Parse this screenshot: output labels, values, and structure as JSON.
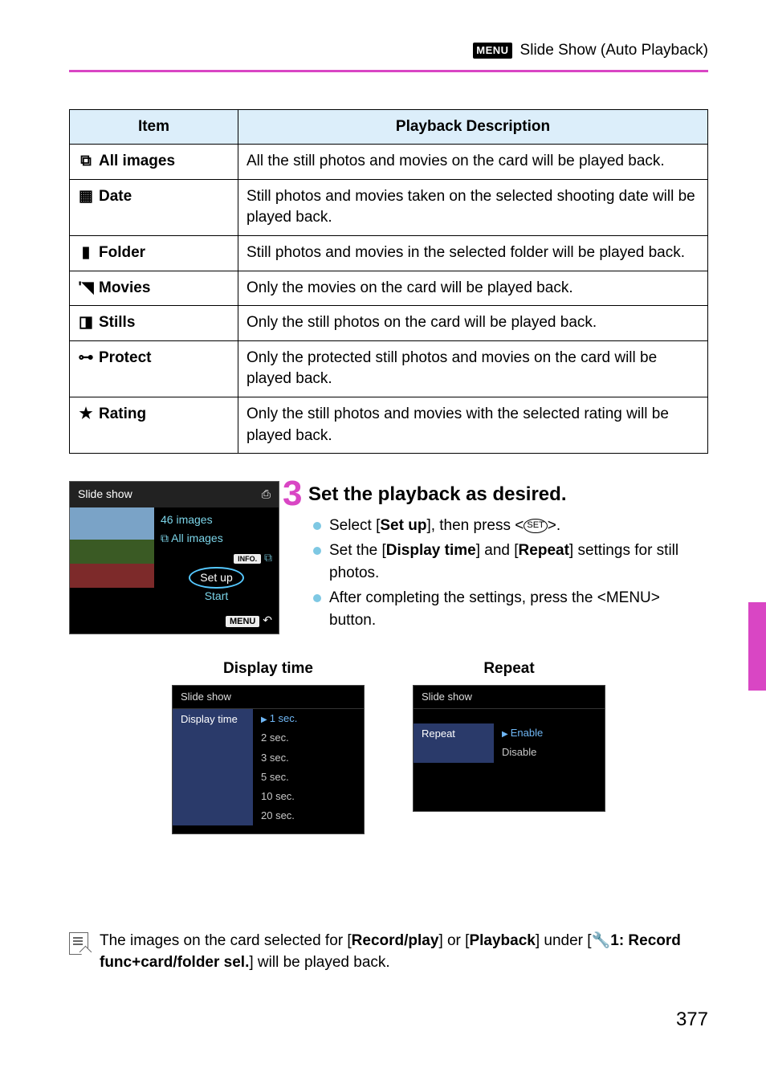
{
  "header": {
    "menu_badge": "MENU",
    "title": "Slide Show (Auto Playback)"
  },
  "table": {
    "headers": {
      "item": "Item",
      "desc": "Playback Description"
    },
    "rows": [
      {
        "icon": "⧉",
        "label": "All images",
        "desc": "All the still photos and movies on the card will be played back."
      },
      {
        "icon": "▦",
        "label": "Date",
        "desc": "Still photos and movies taken on the selected shooting date will be played back."
      },
      {
        "icon": "▮",
        "label": "Folder",
        "desc": "Still photos and movies in the selected folder will be played back."
      },
      {
        "icon": "'◥",
        "label": "Movies",
        "desc": "Only the movies on the card will be played back."
      },
      {
        "icon": "◨",
        "label": "Stills",
        "desc": "Only the still photos on the card will be played back."
      },
      {
        "icon": "⊶",
        "label": "Protect",
        "desc": "Only the protected still photos and movies on the card will be played back."
      },
      {
        "icon": "★",
        "label": "Rating",
        "desc": "Only the still photos and movies with the selected rating will be played back."
      }
    ]
  },
  "step": {
    "number": "3",
    "title": "Set the playback as desired.",
    "bullets": {
      "b1_pre": "Select [",
      "b1_bold": "Set up",
      "b1_mid": "], then press <",
      "b1_set": "SET",
      "b1_post": ">.",
      "b2_pre": "Set the [",
      "b2_b1": "Display time",
      "b2_mid": "] and [",
      "b2_b2": "Repeat",
      "b2_post": "] settings for still photos.",
      "b3_pre": "After completing the settings, press the <",
      "b3_menu": "MENU",
      "b3_post": "> button."
    }
  },
  "cam_main": {
    "title": "Slide show",
    "card_icon": "⎙",
    "count": "46 images",
    "mode_icon": "⧉",
    "mode": "All images",
    "info_badge": "INFO.",
    "setup": "Set up",
    "start": "Start",
    "menu_pill": "MENU",
    "back_arrow": "↶"
  },
  "sub": {
    "display": {
      "label": "Display time",
      "screen_title": "Slide show",
      "row_label": "Display time",
      "options": [
        "1 sec.",
        "2 sec.",
        "3 sec.",
        "5 sec.",
        "10 sec.",
        "20 sec."
      ],
      "selected_index": 0
    },
    "repeat": {
      "label": "Repeat",
      "screen_title": "Slide show",
      "row_label": "Repeat",
      "options": [
        "Enable",
        "Disable"
      ],
      "selected_index": 0
    }
  },
  "note": {
    "pre": "The images on the card selected for [",
    "b1": "Record/play",
    "mid1": "] or [",
    "b2": "Playback",
    "mid2": "] under [",
    "wrench": "🔧",
    "b3": "1: Record func+card/folder sel.",
    "post": "] will be played back."
  },
  "page_number": "377"
}
